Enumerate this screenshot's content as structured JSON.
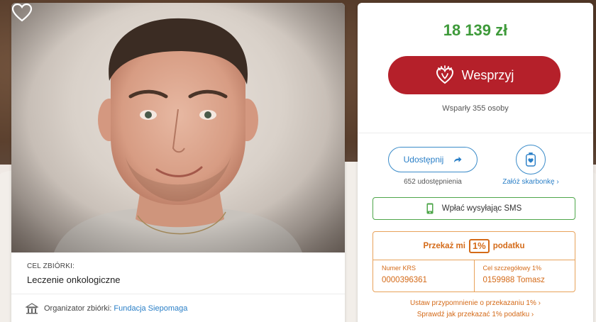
{
  "fundraiser": {
    "goal_label": "CEL ZBIÓRKI:",
    "goal_value": "Leczenie onkologiczne",
    "organizer_prefix": "Organizator zbiórki:",
    "organizer_name": "Fundacja Siepomaga"
  },
  "donation": {
    "amount": "18 139 zł",
    "support_label": "Wesprzyj",
    "supporters_text": "Wsparły 355 osoby"
  },
  "share": {
    "share_label": "Udostępnij",
    "share_count": "652 udostępnienia",
    "piggybank_label": "Załóż skarbonkę"
  },
  "sms": {
    "label": "Wpłać wysyłając SMS"
  },
  "tax": {
    "head_prefix": "Przekaż mi",
    "head_pct": "1%",
    "head_suffix": "podatku",
    "krs_label": "Numer KRS",
    "krs_value": "0000396361",
    "goal_label": "Cel szczegółowy 1%",
    "goal_value": "0159988 Tomasz"
  },
  "links": {
    "reminder": "Ustaw przypomnienie o przekazaniu 1%",
    "howto": "Sprawdź jak przekazać 1% podatku"
  },
  "colors": {
    "amount_green": "#3e9a3a",
    "support_red": "#b5202a",
    "link_blue": "#2a7fc7",
    "tax_orange": "#d46a18"
  },
  "icons": {
    "favorite": "heart-outline-icon",
    "organizer": "building-icon",
    "support": "siepomaga-heart-logo",
    "share": "share-arrow-icon",
    "piggybank": "piggybank-icon",
    "sms": "phone-icon"
  }
}
